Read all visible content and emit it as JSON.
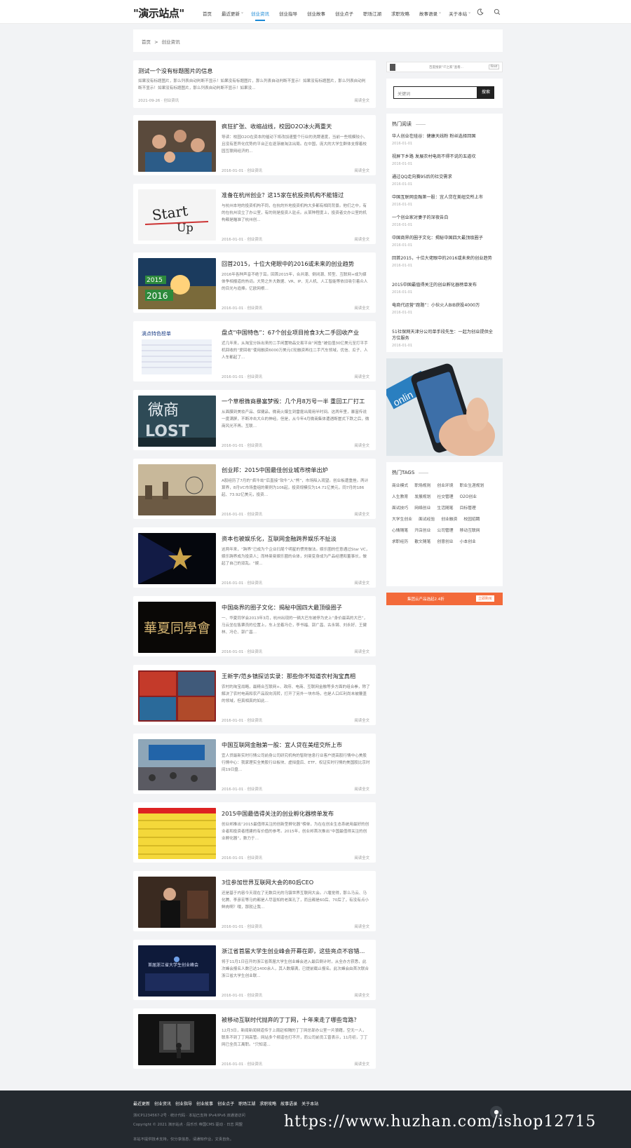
{
  "header": {
    "logo": "\"演示站点\"",
    "nav": [
      "首页",
      "最近更新",
      "创业资讯",
      "创业指导",
      "创业故事",
      "创业点子",
      "职场江湖",
      "求职攻略",
      "故事语录",
      "关于本站"
    ],
    "nav_dropdowns": [
      1,
      8,
      9
    ],
    "active_nav": "创业资讯",
    "theme_icon": "moon-icon",
    "search_icon": "search-icon"
  },
  "breadcrumb": {
    "home": "首页",
    "sep": ">",
    "current": "创业资讯"
  },
  "articles": [
    {
      "title": "测试一个没有标题图片的信息",
      "desc": "如果没有标题图片，那么列表自动判断不显示！如果没有标题图片，那么列表自动判断不显示！如果没有标题图片，那么列表自动判断不显示！如果没有标题图片，那么列表自动判断不显示！如果没...",
      "date": "2021-09-26",
      "cat": "创业资讯",
      "more": "阅读全文"
    },
    {
      "title": "疯狂扩张、收缩战线，校园O2O冰火两重天",
      "desc": "导读：校园O2O在资本的催动下将改加速整个行业的洗牌速度，当前一些规模较小、且没有差异化优势的平台正在逐渐被淘汰出局。在中国，庞大的大学生群体支撑着校园互联网经济的...",
      "date": "2016-01-01",
      "cat": "创业资讯",
      "more": "阅读全文"
    },
    {
      "title": "准备在杭州创业？这15家在杭投资机构不能错过",
      "desc": "与杭州本地的投资机构不同，在杭的外地投资机构大多都有相同背景。他们之中，有的在杭州设立了办公室，有的则是投资人驻点。从某种程度上，投资者交办公室的机构都是瞄准了杭州创...",
      "date": "2016-01-01",
      "cat": "创业资讯",
      "more": "阅读全文"
    },
    {
      "title": "回首2015，十位大佬眼中的2016或未来的创业趋势",
      "desc": "2016年各种声音不绝于耳。回首2015年，合并潮、倒闭潮、转型、互联网+成为媒体争相报道的热词。大势之外大数据、VR、IP、无人机、人工智能等依旧吸引着众人的目光与追捧。亿欧网根...",
      "date": "2016-01-01",
      "cat": "创业资讯",
      "more": "阅读全文"
    },
    {
      "title": "盘点“中国特色”：67个创业项目抢食3大二手回收产业",
      "desc": "近几年来，从淘宝分拆出来的二手闲置物品交易平台“闲鱼”被估值30亿美元至打平手机回收的“爱回收”使用融资6000万美元C轮融资再往二手汽车领域，优信、瓜子、人人车都起了...",
      "date": "2016-01-01",
      "cat": "创业资讯",
      "more": "阅读全文"
    },
    {
      "title": "一个草根微商暴富梦毁：几个月8万号一半 重回工厂打工",
      "desc": "从面膜到美妆产品、保健品，微商火爆生到雷霆出局用半时间。这两年里，暴富传说一度满屏，不断冲击大众的神经。但是，从今年4月微商集体遭遇断崖式下跌之后，微商风光不再。互联...",
      "date": "2016-01-01",
      "cat": "创业资讯",
      "more": "阅读全文"
    },
    {
      "title": "创业邦：2015中国最佳创业城市榜单出炉",
      "desc": "A股经历了7月的“疯牛劫”后直接“软牛”入“熊”，市场陷入观望。创业板遭重挫。两计算界，8月VC市场重组的案例为106起，投资规模仅为14.71亿美元，同7月的186起、73.92亿美元，投资...",
      "date": "2016-01-01",
      "cat": "创业资讯",
      "more": "阅读全文"
    },
    {
      "title": "资本也被娱乐化，互联网金融跨界娱乐不扯淡",
      "desc": "这两年来，“跨界”已成为个企业扫尾个明星的惯常做法。娱乐圈的任意通过Star VC，娱乐跨界成为投资人；而林曼曼娱乐圈的合体，刘曼变身成为产品经理和董事长，做起了自己的双乱。“娱...",
      "date": "2016-01-01",
      "cat": "创业资讯",
      "more": "阅读全文"
    },
    {
      "title": "中国商界的圈子文化：揭秘中国四大最顶级圈子",
      "desc": "一、华夏同学会2013年3月，杭州出现的一辆大巴车被停为史上“身价最高的大巴”，马云坐在售票员的位置上，车上坐着冯仑，李书福、郭广昌、古永锵、刘永好、王健林、冯仑、郭广昌...",
      "date": "2016-01-01",
      "cat": "创业资讯",
      "more": "阅读全文"
    },
    {
      "title": "王新宇/范乡镇探访实录：那些你不知道农村淘宝真相",
      "desc": "农村的淘宝战略，最精合互联网+、政府、电商、互联网金融等多方面的组合拳，除了解决了农村电商和农产品双向流转，打开了另外一块市场，也是人口红利尚未被覆盖的领域，但真相真的如此...",
      "date": "2016-01-01",
      "cat": "创业资讯",
      "more": "阅读全文"
    },
    {
      "title": "中国互联网金融第一股：宜人贷在美纽交所上市",
      "desc": "宜人贷最新实时行情公司前身公司研究机构的智财信息行业客户提高股行情中心美股行情中心：我家理实全美股行业板块、虚拟盘后、ETF、权证实时行情的美国股比京时间19日盘...",
      "date": "2016-01-01",
      "cat": "创业资讯",
      "more": "阅读全文"
    },
    {
      "title": "2015中国最值得关注的创业孵化器榜单发布",
      "desc": "创业邦推出“2015最值得关注的创新型孵化器”榜单，为在在创业生态系统用最好的创业者和投资者搭建的有价值的参考。2015年，创业邦首次推出“中国最值得关注的创业孵化器”，数力于...",
      "date": "2016-01-01",
      "cat": "创业资讯",
      "more": "阅读全文"
    },
    {
      "title": "3位参加世界互联网大会的80后CEO",
      "desc": "还是基于内容今天现在了无数目光的乌镇世界互联网大会。八堰觉得，那么马云、马化腾、李彦宏等马的都是人尽皆知的老面孔了，而且都是60后、70后了，有没有点小鲜肉啊？哦，那就让我...",
      "date": "2016-01-01",
      "cat": "创业资讯",
      "more": "阅读全文"
    },
    {
      "title": "浙江省首届大学生创业峰会开幕在即，这些亮点不容错...",
      "desc": "将于11月1日召开的浙江省首届大学生创业峰会进入最后倒计时，从全办方获悉，此次峰会报名人数已达1400余人，其人数爆满，已提前截止报名。此次峰会由首次联合浙江省大学生创业联...",
      "date": "2016-01-01",
      "cat": "创业资讯",
      "more": "阅读全文"
    },
    {
      "title": "被移动互联时代抛弃的丁丁网，十年来走了哪些弯路？",
      "desc": "12月3日，新闻新闻频道传于上周赶相隔的丁丁网总部办公室一片狼藉，空无一人，联系不到丁丁网高管。网站多个频道也打不开，而公司前员工曾表示，11月初，丁丁网已全员工离职。“只知道...",
      "date": "2016-01-01",
      "cat": "创业资讯",
      "more": "阅读全文"
    }
  ],
  "sidebar": {
    "ad_small": "百度搜索“IT之家”查看...",
    "ad_small_btn": "Find",
    "search_placeholder": "关键词",
    "search_button": "搜索",
    "hot_title": "热门阅读",
    "hot": [
      {
        "title": "华人创业在硅谷：健康天线粉 粉丝选择回国",
        "date": "2016-01-01"
      },
      {
        "title": "视屏下乡路 发展农村电商不得不说的五道坎",
        "date": "2016-01-01"
      },
      {
        "title": "通过QQ走向赛95后的社交需求",
        "date": "2016-01-01"
      },
      {
        "title": "中国互联网金融第一股：宜人贷在美纽交所上市",
        "date": "2016-01-01"
      },
      {
        "title": "一个创业家对妻子的深夜告白",
        "date": "2016-01-01"
      },
      {
        "title": "中国商界的圈子文化：揭秘中国四大最顶级圈子",
        "date": "2016-01-01"
      },
      {
        "title": "回首2015，十位大佬眼中的2016或未来的创业趋势",
        "date": "2016-01-01"
      },
      {
        "title": "2015中国最值得关注的创业孵化器榜单发布",
        "date": "2016-01-01"
      },
      {
        "title": "电商代运营“跑路”：小伙火人BIB获投4000万",
        "date": "2016-01-01"
      },
      {
        "title": "51社保网天津分公司单手段先生：一起为创业提供全方位服务",
        "date": "2016-01-01"
      }
    ],
    "tags_title": "热门TAGS",
    "tags": [
      "商业模式",
      "职场规则",
      "创业环境",
      "职业生涯规划",
      "人生教育",
      "发展规划",
      "社交管理",
      "O2O创业",
      "面试技巧",
      "网络创业",
      "生活随笔",
      "目标管理",
      "大学生创业",
      "面试经验",
      "创业融资",
      "校园招聘",
      "心情随笔",
      "开店创业",
      "公司管理",
      "移动互联网",
      "求职经历",
      "散文随笔",
      "创意创业",
      "小本创业"
    ],
    "banner_text": "集团云产品选起2.4折",
    "banner_btn": "立即购买"
  },
  "footer": {
    "links": [
      "最近更新",
      "创业资讯",
      "创业指导",
      "创业故事",
      "创业点子",
      "职场江湖",
      "求职攻略",
      "故事语录",
      "关于本站"
    ],
    "line1": "浙ICP1234567-2号 · 统计代码 · 本站已支持 IPv4/IPv6 双通道访问",
    "line2": "Copyright © 2021 演示站点 · 段乐乐 帝国CMS 驱动 · 日志 网盟",
    "line3": "本站不提供技术支持，仅分享信息，请通知作业，文责自负。",
    "watermark": "https://www.huzhan.com/ishop12715",
    "chat_icon": "chat-icon"
  }
}
